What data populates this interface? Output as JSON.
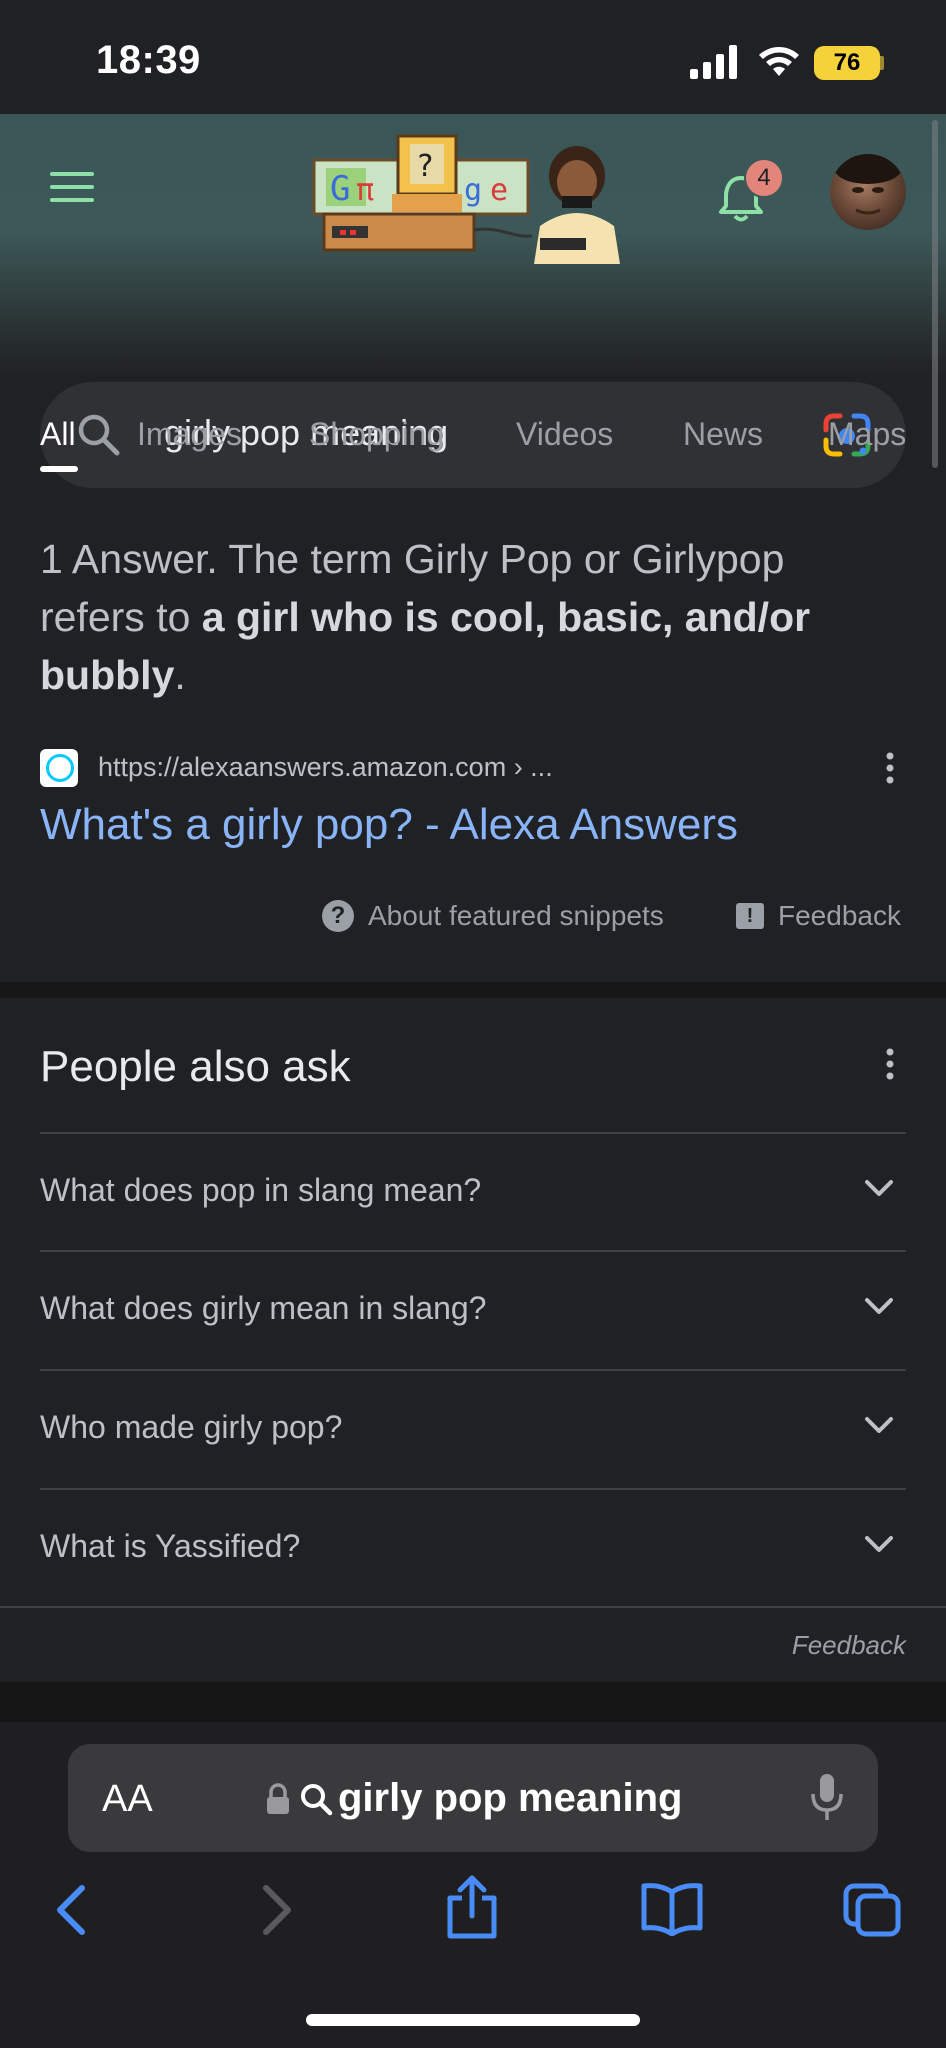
{
  "status_bar": {
    "time": "18:39",
    "battery": "76"
  },
  "header": {
    "notification_count": "4"
  },
  "search": {
    "query": "girly pop meaning"
  },
  "tabs": [
    "All",
    "Images",
    "Shopping",
    "Videos",
    "News",
    "Maps"
  ],
  "snippet": {
    "answer_prefix": "1 Answer. The term Girly Pop or Girlypop refers to ",
    "answer_bold": "a girl who is cool, basic, and/or bubbly",
    "answer_suffix": ".",
    "source_url": "https://alexaanswers.amazon.com › ...",
    "link_title": "What's a girly pop? - Alexa Answers",
    "about_label": "About featured snippets",
    "feedback_label": "Feedback"
  },
  "people_also_ask": {
    "title": "People also ask",
    "questions": [
      "What does pop in slang mean?",
      "What does girly mean in slang?",
      "Who made girly pop?",
      "What is Yassified?"
    ],
    "feedback_label": "Feedback"
  },
  "safari": {
    "aa_label": "AA",
    "address_text": "girly pop meaning"
  },
  "colors": {
    "link": "#8ab4f8",
    "accent_green": "#8ee0a6",
    "badge": "#e4857b",
    "battery": "#f5d13a"
  }
}
